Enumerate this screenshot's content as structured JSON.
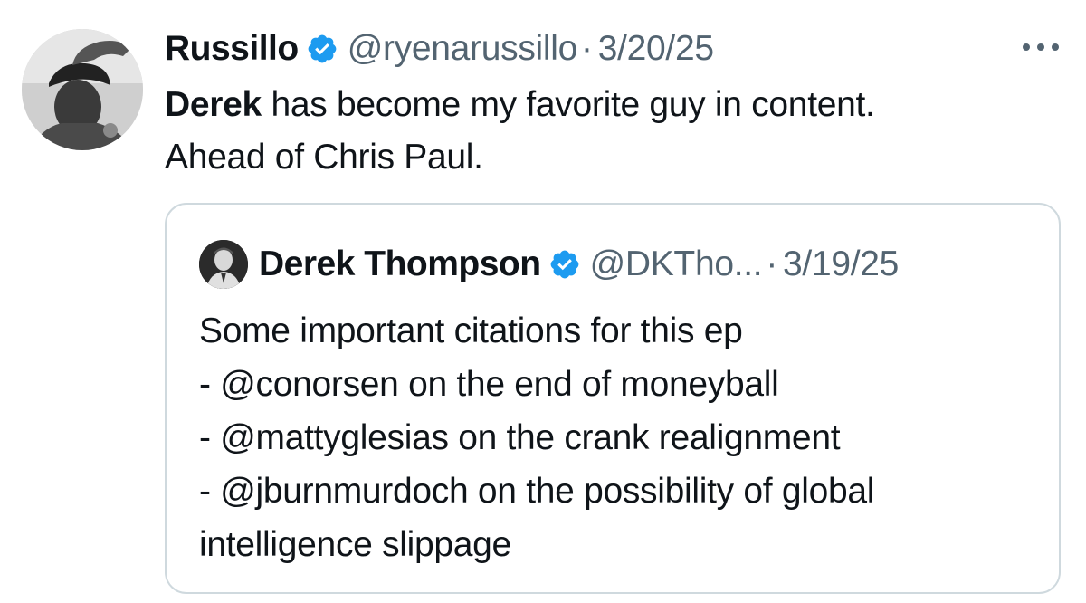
{
  "tweet": {
    "author": {
      "display_name": "Russillo",
      "handle": "@ryenarussillo",
      "verified": true,
      "avatar_icon": "user-avatar-photo"
    },
    "separator": "·",
    "date": "3/20/25",
    "more_icon": "more-options-icon",
    "body": {
      "line1_bold": "Derek",
      "line1_rest": " has become my favorite guy in content.",
      "line2": "Ahead of Chris Paul."
    }
  },
  "quote": {
    "author": {
      "display_name": "Derek Thompson",
      "handle": "@DKTho...",
      "verified": true,
      "avatar_icon": "user-avatar-photo"
    },
    "separator": "·",
    "date": "3/19/25",
    "body_lines": [
      "Some important citations for this ep",
      "- @conorsen on the end of moneyball",
      "- @mattyglesias on the crank realignment",
      "- @jburnmurdoch on the possibility of global",
      "intelligence slippage"
    ]
  },
  "colors": {
    "text_primary": "#0f1419",
    "text_secondary": "#536471",
    "verified_blue": "#1d9bf0",
    "border": "#cfd9de"
  }
}
